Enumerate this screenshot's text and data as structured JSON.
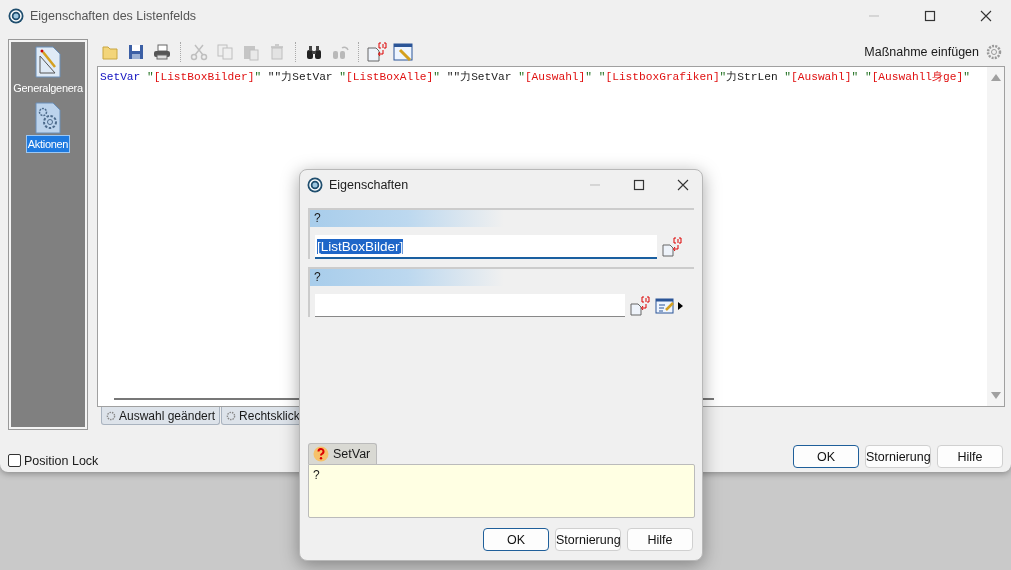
{
  "window": {
    "title": "Eigenschaften des Listenfelds"
  },
  "sidebar": {
    "items": [
      {
        "label": "Generalgenera",
        "kind": "general",
        "selected": false
      },
      {
        "label": "Aktionen",
        "kind": "actions",
        "selected": true
      }
    ]
  },
  "toolbar": {
    "groups": [
      [
        {
          "kind": "folder",
          "disabled": false
        },
        {
          "kind": "save",
          "disabled": false
        },
        {
          "kind": "print",
          "disabled": false
        }
      ],
      [
        {
          "kind": "cut",
          "disabled": true
        },
        {
          "kind": "copy",
          "disabled": true
        },
        {
          "kind": "paste",
          "disabled": true
        },
        {
          "kind": "delete",
          "disabled": true
        }
      ],
      [
        {
          "kind": "find",
          "disabled": false
        },
        {
          "kind": "replace",
          "disabled": true
        }
      ],
      [
        {
          "kind": "variable",
          "disabled": false
        },
        {
          "kind": "editor",
          "disabled": false
        }
      ]
    ],
    "insert_action": "Maßnahme einfügen"
  },
  "editor": {
    "code": [
      {
        "kind": "cmd",
        "text": "SetVar "
      },
      {
        "kind": "quote",
        "text": "\""
      },
      {
        "kind": "str",
        "text": "[ListBoxBilder]"
      },
      {
        "kind": "quote",
        "text": "\""
      },
      {
        "kind": "plain",
        "text": " \"\"力SetVar "
      },
      {
        "kind": "quote",
        "text": "\""
      },
      {
        "kind": "str",
        "text": "[ListBoxAlle]"
      },
      {
        "kind": "quote",
        "text": "\""
      },
      {
        "kind": "plain",
        "text": " \"\"力SetVar "
      },
      {
        "kind": "quote",
        "text": "\""
      },
      {
        "kind": "str",
        "text": "[Auswahl]"
      },
      {
        "kind": "quote",
        "text": "\" \""
      },
      {
        "kind": "str",
        "text": "[ListboxGrafiken]"
      },
      {
        "kind": "quote",
        "text": "\""
      },
      {
        "kind": "plain",
        "text": "力StrLen "
      },
      {
        "kind": "quote",
        "text": "\""
      },
      {
        "kind": "str",
        "text": "[Auswahl]"
      },
      {
        "kind": "quote",
        "text": "\" \""
      },
      {
        "kind": "str",
        "text": "[Auswahll身ge]"
      },
      {
        "kind": "quote",
        "text": "\""
      }
    ]
  },
  "event_tabs": [
    {
      "label": "Auswahl geändert",
      "selected": false
    },
    {
      "label": "Rechtsklick",
      "selected": false
    }
  ],
  "position_lock": {
    "label": "Position Lock",
    "checked": false
  },
  "buttons": [
    {
      "label": "OK",
      "default": true
    },
    {
      "label": "Stornierung",
      "default": false
    },
    {
      "label": "Hilfe",
      "default": false
    }
  ],
  "dialog": {
    "title": "Eigenschaften",
    "params": [
      {
        "header": "?",
        "value": "[ListBoxBilder]",
        "focused": true,
        "value_selected": true,
        "tools": [
          {
            "kind": "variable"
          }
        ]
      },
      {
        "header": "?",
        "focused": false,
        "tools": [
          {
            "kind": "variable"
          },
          {
            "kind": "editor"
          },
          {
            "kind": "menu"
          }
        ]
      }
    ],
    "help": {
      "tab": "SetVar",
      "text": "?"
    },
    "buttons": [
      {
        "label": "OK",
        "default": true
      },
      {
        "label": "Stornierung",
        "default": false
      },
      {
        "label": "Hilfe",
        "default": false
      }
    ]
  }
}
